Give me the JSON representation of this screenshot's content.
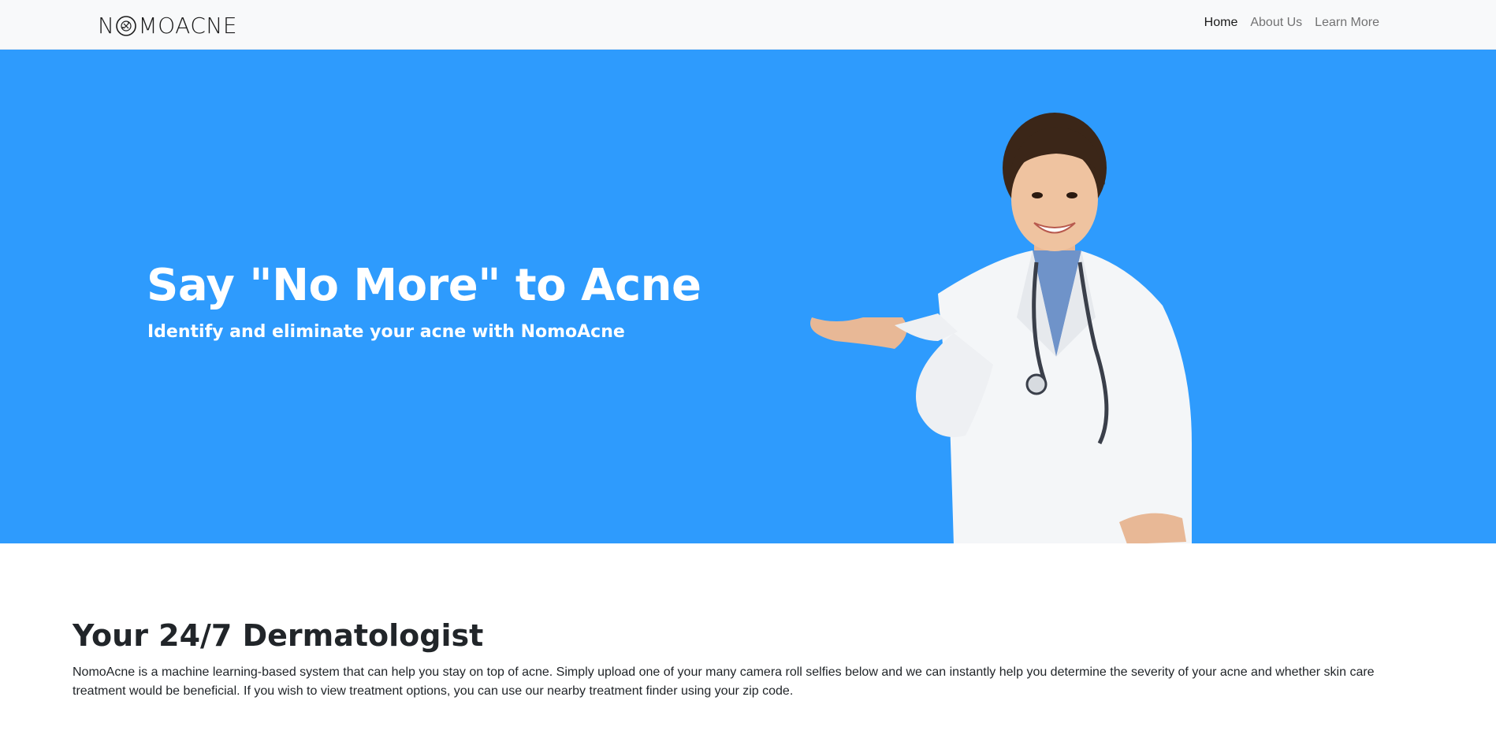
{
  "navbar": {
    "brand_prefix": "N",
    "brand_suffix": "MOACNE",
    "links": [
      {
        "label": "Home",
        "active": true
      },
      {
        "label": "About Us",
        "active": false
      },
      {
        "label": "Learn More",
        "active": false
      }
    ]
  },
  "hero": {
    "title": "Say \"No More\" to Acne",
    "subtitle": "Identify and eliminate your acne with NomoAcne",
    "background_color": "#2e9bfd"
  },
  "about": {
    "title": "Your 24/7 Dermatologist",
    "body": "NomoAcne is a machine learning-based system that can help you stay on top of acne. Simply upload one of your many camera roll selfies below and we can instantly help you determine the severity of your acne and whether skin care treatment would be beneficial. If you wish to view treatment options, you can use our nearby treatment finder using your zip code."
  },
  "icons": {
    "brand_logo": "nomoacne-logo-icon"
  }
}
